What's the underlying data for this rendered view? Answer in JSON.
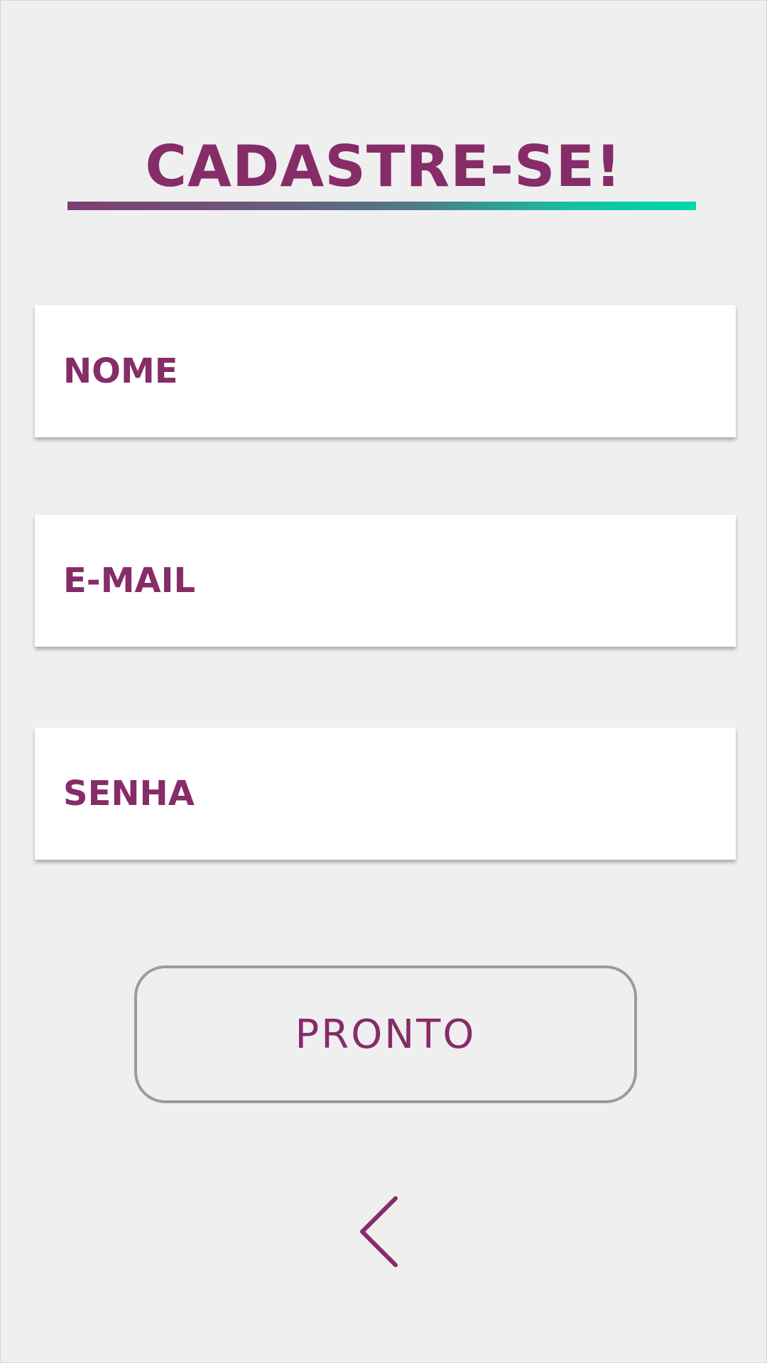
{
  "header": {
    "title": "CADASTRE-SE!"
  },
  "form": {
    "fields": [
      {
        "label": "NOME"
      },
      {
        "label": "E-MAIL"
      },
      {
        "label": "SENHA"
      }
    ],
    "submit_label": "PRONTO"
  },
  "navigation": {
    "back_icon": "chevron-left-icon"
  },
  "colors": {
    "brand_purple": "#862c68",
    "accent_green": "#00d8a9",
    "background": "#efefef",
    "button_border": "#9b9b9b"
  }
}
